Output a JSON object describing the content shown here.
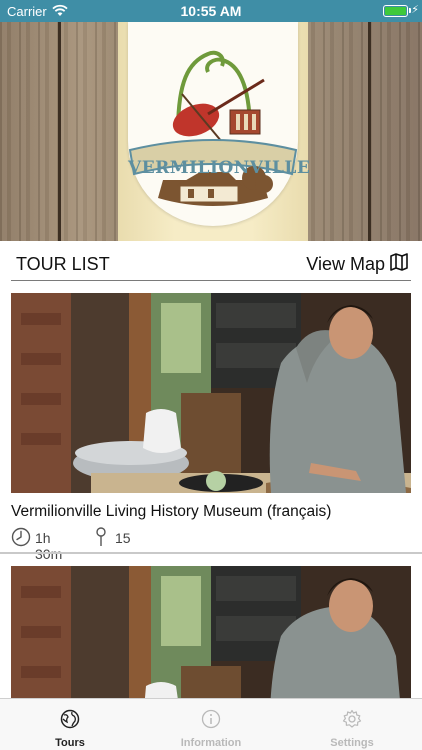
{
  "status_bar": {
    "carrier": "Carrier",
    "time": "10:55 AM",
    "battery_level": 1.0
  },
  "header": {
    "logo_text": "VERMILIONVILLE",
    "logo_icon": "vermilionville-logo"
  },
  "section": {
    "title": "TOUR LIST",
    "view_map_label": "View Map",
    "view_map_icon": "map-icon"
  },
  "tours": [
    {
      "title": "Vermilionville Living History Museum (français)",
      "duration": "1h 30m",
      "stops": "15",
      "photo": "woman-chopping-vegetables-photo"
    },
    {
      "photo": "woman-chopping-vegetables-photo"
    }
  ],
  "tab_bar": {
    "tabs": [
      {
        "label": "Tours",
        "icon": "globe-icon",
        "active": true
      },
      {
        "label": "Information",
        "icon": "info-icon",
        "active": false
      },
      {
        "label": "Settings",
        "icon": "gear-icon",
        "active": false
      }
    ]
  },
  "colors": {
    "status_bar": "#3f8ea6",
    "logo_accent": "#5d8fa0",
    "tab_active": "#222222",
    "tab_inactive": "#b9b9b9"
  }
}
